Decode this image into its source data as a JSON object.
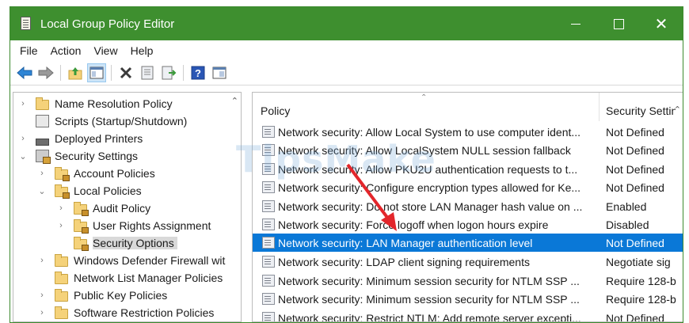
{
  "window": {
    "title": "Local Group Policy Editor",
    "accent_color": "#3e8f2f",
    "controls": {
      "minimize_icon": "minimize-icon",
      "maximize_icon": "maximize-icon",
      "close_glyph": "✕"
    }
  },
  "menu": [
    "File",
    "Action",
    "View",
    "Help"
  ],
  "toolbar": {
    "icons": [
      "back-arrow-icon",
      "forward-arrow-icon",
      "up-folder-icon",
      "show-hide-tree-icon",
      "delete-icon",
      "properties-icon",
      "export-list-icon",
      "help-icon",
      "console-view-icon"
    ]
  },
  "tree": {
    "items": [
      {
        "label": "Name Resolution Policy",
        "icon": "folder-icon",
        "chevron": "›"
      },
      {
        "label": "Scripts (Startup/Shutdown)",
        "icon": "script-icon",
        "chevron": ""
      },
      {
        "label": "Deployed Printers",
        "icon": "printer-icon",
        "chevron": "›"
      },
      {
        "label": "Security Settings",
        "icon": "security-settings-icon",
        "chevron": "⌄"
      },
      {
        "label": "Account Policies",
        "icon": "lock-folder-icon",
        "chevron": "›"
      },
      {
        "label": "Local Policies",
        "icon": "lock-folder-icon",
        "chevron": "⌄"
      },
      {
        "label": "Audit Policy",
        "icon": "lock-folder-icon",
        "chevron": "›"
      },
      {
        "label": "User Rights Assignment",
        "icon": "lock-folder-icon",
        "chevron": "›"
      },
      {
        "label": "Security Options",
        "icon": "lock-folder-icon",
        "chevron": "",
        "selected": true
      },
      {
        "label": "Windows Defender Firewall wit",
        "icon": "folder-icon",
        "chevron": "›"
      },
      {
        "label": "Network List Manager Policies",
        "icon": "folder-icon",
        "chevron": ""
      },
      {
        "label": "Public Key Policies",
        "icon": "folder-icon",
        "chevron": "›"
      },
      {
        "label": "Software Restriction Policies",
        "icon": "folder-icon",
        "chevron": "›"
      }
    ]
  },
  "list": {
    "columns": {
      "policy": "Policy",
      "setting": "Security Settin"
    },
    "rows": [
      {
        "policy": "Network security: Allow Local System to use computer ident...",
        "setting": "Not Defined"
      },
      {
        "policy": "Network security: Allow LocalSystem NULL session fallback",
        "setting": "Not Defined"
      },
      {
        "policy": "Network security: Allow PKU2U authentication requests to t...",
        "setting": "Not Defined"
      },
      {
        "policy": "Network security: Configure encryption types allowed for Ke...",
        "setting": "Not Defined"
      },
      {
        "policy": "Network security: Do not store LAN Manager hash value on ...",
        "setting": "Enabled"
      },
      {
        "policy": "Network security: Force logoff when logon hours expire",
        "setting": "Disabled"
      },
      {
        "policy": "Network security: LAN Manager authentication level",
        "setting": "Not Defined",
        "selected": true
      },
      {
        "policy": "Network security: LDAP client signing requirements",
        "setting": "Negotiate sig"
      },
      {
        "policy": "Network security: Minimum session security for NTLM SSP ...",
        "setting": "Require 128-b"
      },
      {
        "policy": "Network security: Minimum session security for NTLM SSP ...",
        "setting": "Require 128-b"
      },
      {
        "policy": "Network security: Restrict NTLM: Add remote server excepti...",
        "setting": "Not Defined"
      }
    ],
    "selection_color": "#0a78d7"
  },
  "watermark": {
    "text": "TipsMake"
  }
}
